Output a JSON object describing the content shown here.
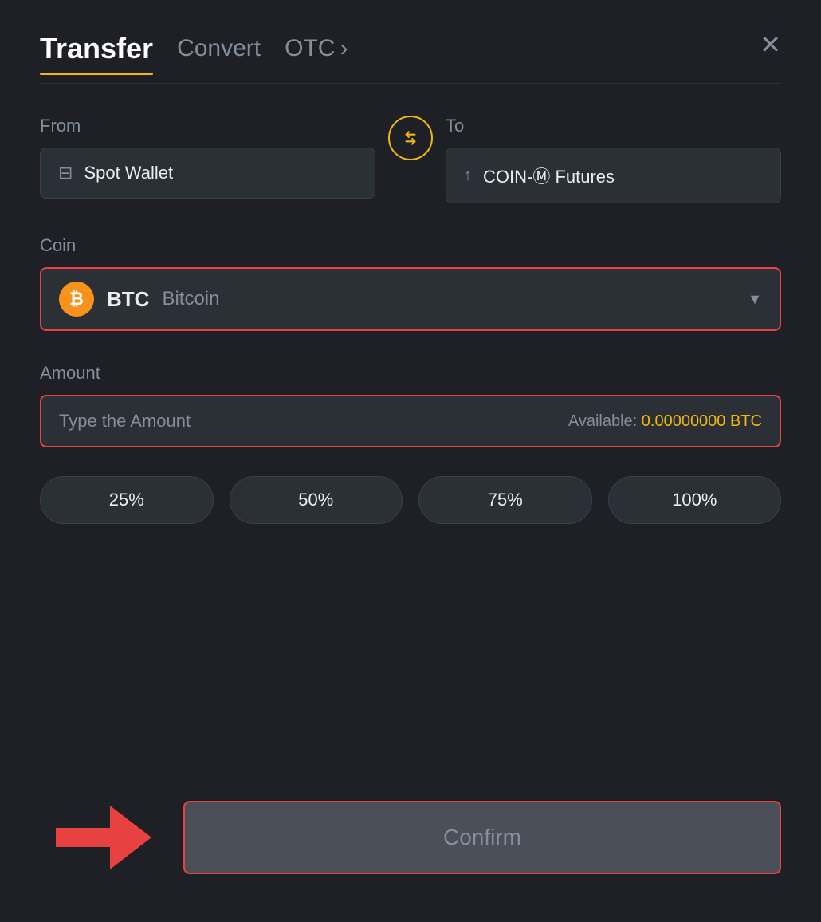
{
  "header": {
    "title": "Transfer",
    "tab_convert": "Convert",
    "tab_otc": "OTC",
    "tab_otc_arrow": "›",
    "close_label": "✕"
  },
  "from_section": {
    "label": "From",
    "wallet_name": "Spot Wallet"
  },
  "to_section": {
    "label": "To",
    "wallet_name": "COIN-Ⓜ Futures"
  },
  "coin_section": {
    "label": "Coin",
    "coin_symbol": "BTC",
    "coin_full_name": "Bitcoin",
    "chevron": "▼"
  },
  "amount_section": {
    "label": "Amount",
    "placeholder": "Type the Amount",
    "available_label": "Available:",
    "available_value": "0.00000000 BTC"
  },
  "pct_buttons": [
    "25%",
    "50%",
    "75%",
    "100%"
  ],
  "confirm_button": {
    "label": "Confirm"
  },
  "colors": {
    "accent": "#f0b90b",
    "danger": "#e84142",
    "bg": "#1e2026",
    "surface": "#2b2f36",
    "text_muted": "#848e9c",
    "text_main": "#eaecef"
  }
}
